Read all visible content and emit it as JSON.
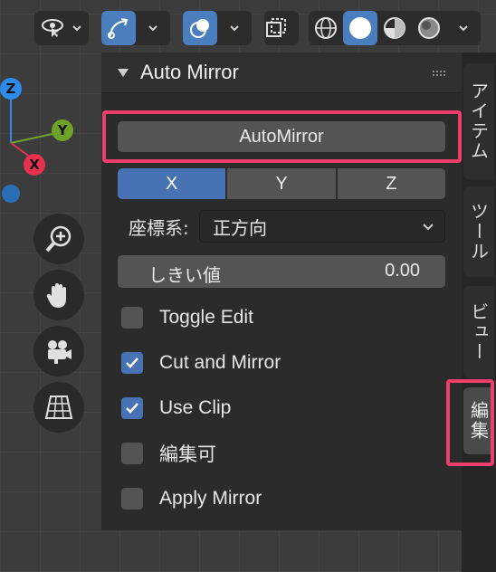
{
  "gizmo": {
    "z_label": "Z",
    "y_label": "Y",
    "x_label": "X"
  },
  "panel": {
    "title": "Auto Mirror",
    "automirror_button": "AutoMirror",
    "axes": [
      "X",
      "Y",
      "Z"
    ],
    "active_axis": "X",
    "coord_label": "座標系:",
    "coord_value": "正方向",
    "threshold_label": "しきい値",
    "threshold_value": "0.00",
    "checkboxes": [
      {
        "label": "Toggle Edit",
        "checked": false
      },
      {
        "label": "Cut and Mirror",
        "checked": true
      },
      {
        "label": "Use Clip",
        "checked": true
      },
      {
        "label": "編集可",
        "checked": false
      },
      {
        "label": "Apply Mirror",
        "checked": false
      }
    ]
  },
  "tabs": [
    "アイテム",
    "ツール",
    "ビュー",
    "編集"
  ],
  "active_tab": "編集",
  "colors": {
    "highlight": "#ee3f6c",
    "accent": "#4772b3",
    "x_axis": "#e8304f",
    "y_axis": "#6fa228",
    "z_axis": "#2d8ceb"
  }
}
